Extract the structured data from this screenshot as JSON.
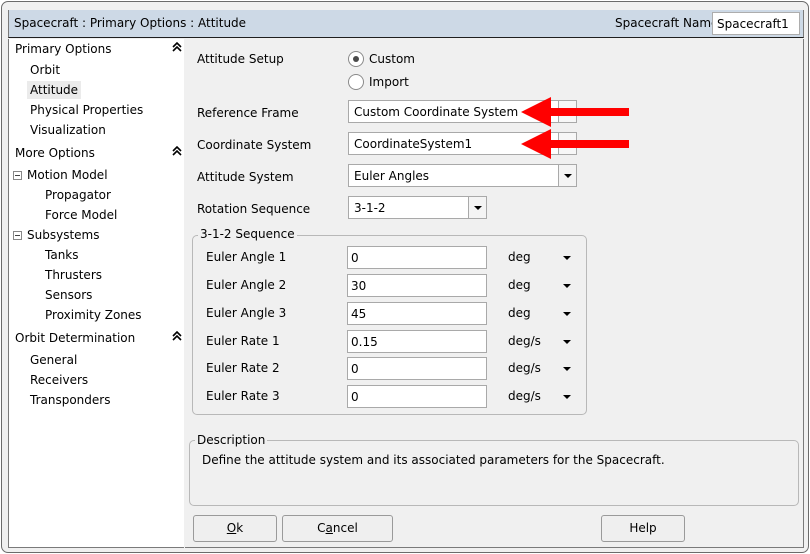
{
  "window": {
    "breadcrumb": "Spacecraft : Primary Options : Attitude",
    "spacecraft_name_label": "Spacecraft Name",
    "spacecraft_name_value": "Spacecraft1"
  },
  "sidebar": {
    "sections": [
      {
        "label": "Primary Options",
        "collapse_icon": "double-chevron-up-icon",
        "items": [
          "Orbit",
          "Attitude",
          "Physical Properties",
          "Visualization"
        ]
      },
      {
        "label": "More Options",
        "collapse_icon": "double-chevron-up-icon",
        "groups": [
          {
            "label": "Motion Model",
            "toggle": "minus",
            "items": [
              "Propagator",
              "Force Model"
            ]
          },
          {
            "label": "Subsystems",
            "toggle": "minus",
            "items": [
              "Tanks",
              "Thrusters",
              "Sensors",
              "Proximity Zones"
            ]
          }
        ]
      },
      {
        "label": "Orbit Determination",
        "collapse_icon": "double-chevron-up-icon",
        "items": [
          "General",
          "Receivers",
          "Transponders"
        ]
      }
    ],
    "selected": "Attitude",
    "collapse_glyph": "⌃"
  },
  "form": {
    "attitude_setup": {
      "label": "Attitude Setup",
      "options": [
        "Custom",
        "Import"
      ],
      "selected": "Custom"
    },
    "reference_frame": {
      "label": "Reference Frame",
      "value": "Custom Coordinate System"
    },
    "coordinate_system": {
      "label": "Coordinate System",
      "value": "CoordinateSystem1"
    },
    "attitude_system": {
      "label": "Attitude System",
      "value": "Euler Angles"
    },
    "rotation_sequence": {
      "label": "Rotation Sequence",
      "value": "3-1-2"
    },
    "sequence_group": {
      "title": "3-1-2 Sequence",
      "rows": [
        {
          "label": "Euler Angle 1",
          "value": "0",
          "unit": "deg"
        },
        {
          "label": "Euler Angle 2",
          "value": "30",
          "unit": "deg"
        },
        {
          "label": "Euler Angle 3",
          "value": "45",
          "unit": "deg"
        },
        {
          "label": "Euler Rate 1",
          "value": "0.15",
          "unit": "deg/s"
        },
        {
          "label": "Euler Rate 2",
          "value": "0",
          "unit": "deg/s"
        },
        {
          "label": "Euler Rate 3",
          "value": "0",
          "unit": "deg/s"
        }
      ]
    }
  },
  "description": {
    "title": "Description",
    "text": "Define the attitude system and its associated parameters for the Spacecraft."
  },
  "buttons": {
    "ok": {
      "pre": "",
      "mnemonic": "O",
      "post": "k"
    },
    "cancel": {
      "pre": "C",
      "mnemonic": "a",
      "post": "ncel"
    },
    "help": "Help"
  },
  "annotations": {
    "arrow_color": "#ff0000",
    "arrows": [
      "reference-frame-arrow",
      "coordinate-system-arrow"
    ]
  }
}
